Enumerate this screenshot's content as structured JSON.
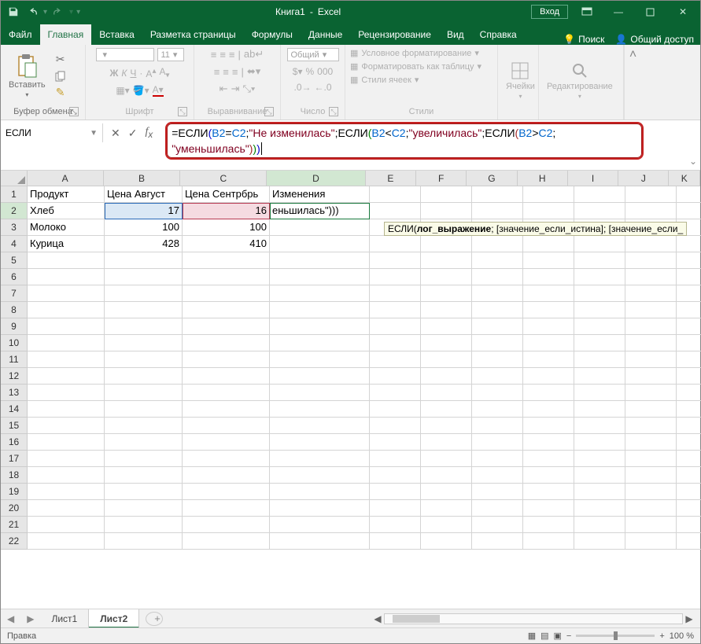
{
  "titlebar": {
    "doc": "Книга1",
    "app": "Excel",
    "login": "Вход"
  },
  "tabs": {
    "file": "Файл",
    "home": "Главная",
    "insert": "Вставка",
    "layout": "Разметка страницы",
    "formulas": "Формулы",
    "data": "Данные",
    "review": "Рецензирование",
    "view": "Вид",
    "help": "Справка",
    "search": "Поиск",
    "share": "Общий доступ"
  },
  "ribbon": {
    "clipboard": {
      "paste": "Вставить",
      "label": "Буфер обмена"
    },
    "font": {
      "label": "Шрифт",
      "size": "11"
    },
    "align": {
      "label": "Выравнивание"
    },
    "number": {
      "label": "Число",
      "format": "Общий"
    },
    "styles": {
      "label": "Стили",
      "cond": "Условное форматирование",
      "table": "Форматировать как таблицу",
      "cell": "Стили ячеек"
    },
    "cells": {
      "label": "Ячейки"
    },
    "editing": {
      "label": "Редактирование"
    }
  },
  "namebox": {
    "value": "ЕСЛИ"
  },
  "formula": {
    "fn": "ЕСЛИ",
    "line1_prefix": "=",
    "arg1_ref1": "B2",
    "arg1_op": "=",
    "arg1_ref2": "C2",
    "str1": "\"Не изменилась\"",
    "arg2_ref1": "B2",
    "arg2_op": "<",
    "arg2_ref2": "C2",
    "str2": "\"увеличилась\"",
    "arg3_ref1": "B2",
    "arg3_op": ">",
    "arg3_ref2": "C2",
    "str3": "\"уменьшилась\""
  },
  "tooltip": {
    "fn": "ЕСЛИ(",
    "arg1": "лог_выражение",
    "sep": "; ",
    "arg2": "[значение_если_истина]",
    "arg3": "[значение_если_"
  },
  "chart_data": {
    "type": "table",
    "columns": [
      "",
      "A",
      "B",
      "C",
      "D"
    ],
    "headers_row": [
      "Продукт",
      "Цена Август",
      "Цена Сентрбрь",
      "Изменения"
    ],
    "rows": [
      {
        "a": "Хлеб",
        "b": "17",
        "c": "16",
        "d": "еньшилась\")))"
      },
      {
        "a": "Молоко",
        "b": "100",
        "c": "100",
        "d": ""
      },
      {
        "a": "Курица",
        "b": "428",
        "c": "410",
        "d": ""
      }
    ],
    "col_widths": {
      "A": 98,
      "B": 99,
      "C": 111,
      "D": 127,
      "rest": 65
    },
    "active_cell": "D2",
    "ref_cells": [
      "B2",
      "C2"
    ]
  },
  "sheets": {
    "s1": "Лист1",
    "s2": "Лист2"
  },
  "status": {
    "mode": "Правка",
    "zoom": "100 %"
  }
}
